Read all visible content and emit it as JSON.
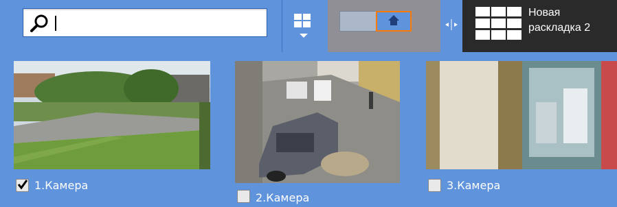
{
  "search": {
    "value": "",
    "placeholder": ""
  },
  "new_layout": {
    "label": "Новая\nраскладка 2"
  },
  "cameras": [
    {
      "label": "1.Камера",
      "checked": true
    },
    {
      "label": "2.Камера",
      "checked": false
    },
    {
      "label": "3.Камера",
      "checked": false
    }
  ],
  "colors": {
    "background": "#5f93dc",
    "active_layout_border": "#ff7a00",
    "new_layout_bg": "#2a2a2a"
  }
}
